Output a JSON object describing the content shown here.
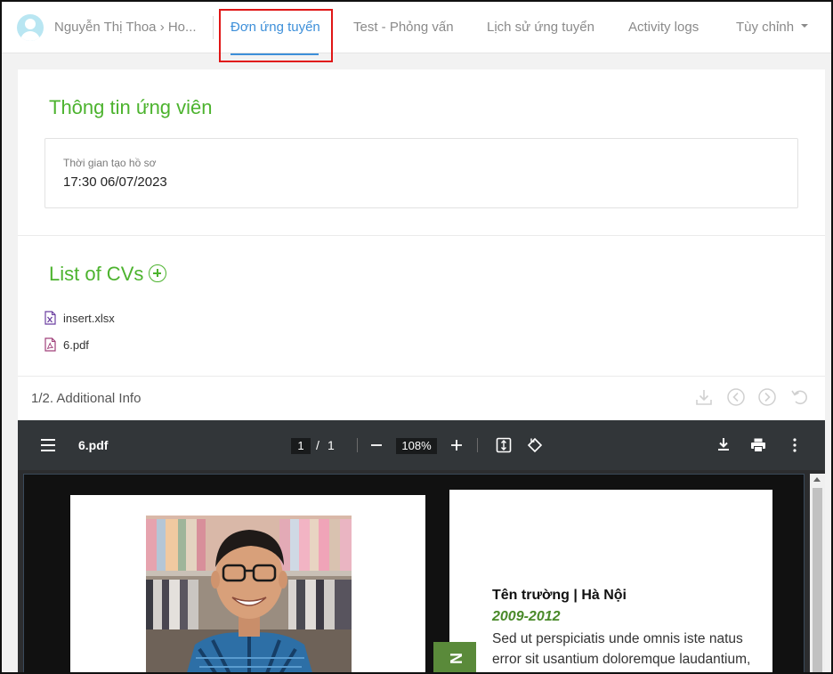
{
  "header": {
    "breadcrumb": "Nguyễn Thị Thoa › Ho...",
    "tabs": [
      {
        "label": "Đơn ứng tuyển",
        "active": true
      },
      {
        "label": "Test - Phỏng vấn"
      },
      {
        "label": "Lịch sử ứng tuyển"
      },
      {
        "label": "Activity logs"
      },
      {
        "label": "Tùy chỉnh"
      }
    ]
  },
  "candidate": {
    "section_title": "Thông tin ứng viên",
    "created_label": "Thời gian tạo hồ sơ",
    "created_value": "17:30 06/07/2023"
  },
  "cvs": {
    "section_title": "List of CVs",
    "files": [
      {
        "name": "insert.xlsx",
        "icon": "excel-file-icon"
      },
      {
        "name": "6.pdf",
        "icon": "pdf-file-icon"
      }
    ]
  },
  "attachments": {
    "label": "1/2. Additional Info"
  },
  "viewer": {
    "filename": "6.pdf",
    "page_current": "1",
    "page_sep": "/",
    "page_total": "1",
    "zoom": "108%"
  },
  "cv_page": {
    "school": "Tên trường | Hà Nội",
    "years": "2009-2012",
    "body": "Sed ut perspiciatis unde omnis iste natus error sit usantium doloremque laudantium,",
    "side_tab_letter": "N"
  },
  "colors": {
    "accent_green": "#4cb32e",
    "tab_blue": "#3d8fd9",
    "highlight_red": "#e01616",
    "viewer_bar": "#323639"
  }
}
